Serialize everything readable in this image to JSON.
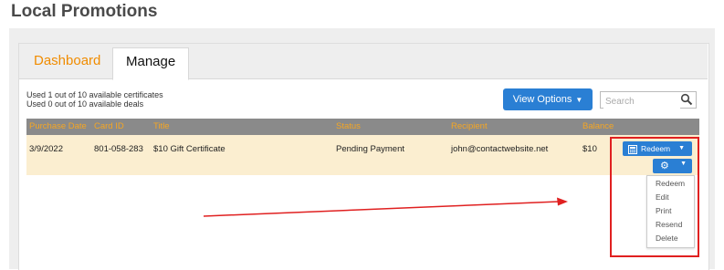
{
  "page_title": "Local Promotions",
  "tabs": [
    {
      "label": "Dashboard",
      "active": false
    },
    {
      "label": "Manage",
      "active": true
    }
  ],
  "usage": {
    "certificates": "Used 1 out of 10 available certificates",
    "deals": "Used 0 out of 10 available deals"
  },
  "toolbar": {
    "view_options_label": "View Options",
    "search_placeholder": "Search",
    "search_value": ""
  },
  "table": {
    "columns": [
      "Purchase Date",
      "Card ID",
      "Title",
      "Status",
      "Recipient",
      "Balance"
    ],
    "rows": [
      {
        "purchase_date": "3/9/2022",
        "card_id": "801-058-283",
        "title": "$10 Gift Certificate",
        "status": "Pending Payment",
        "recipient": "john@contactwebsite.net",
        "balance": "$10"
      }
    ]
  },
  "actions": {
    "redeem_label": "Redeem",
    "menu_items": [
      "Redeem",
      "Edit",
      "Print",
      "Resend",
      "Delete"
    ]
  },
  "icons": {
    "search": "magnifier-icon",
    "redeem": "calculator-icon",
    "gear": "gear-icon",
    "caret": "caret-down-icon"
  },
  "colors": {
    "accent_orange": "#f08c00",
    "button_blue": "#2a7fd4",
    "header_gray": "#8a8a8a",
    "row_highlight": "#fbeed0",
    "annotation_red": "#e02020"
  }
}
